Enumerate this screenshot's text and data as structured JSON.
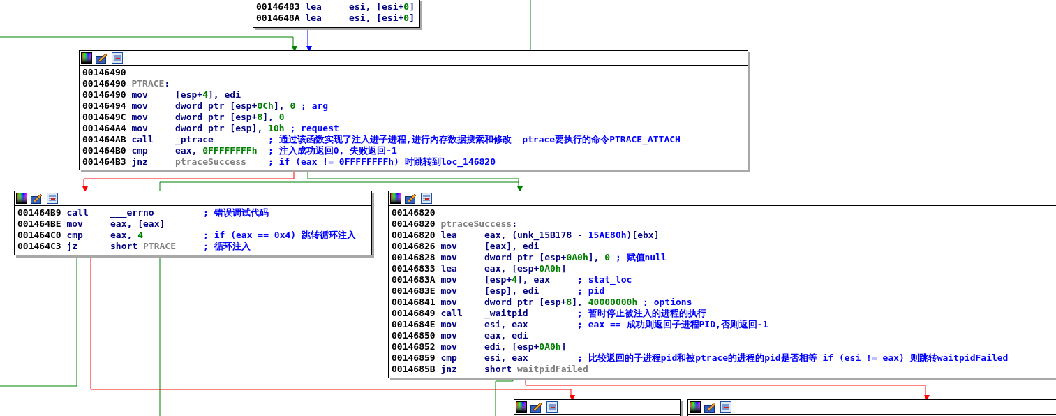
{
  "nodes": [
    {
      "toolbar": false,
      "lines": [
        {
          "kind": "insn",
          "address": "00146483",
          "mnemonic": "lea",
          "operands": [
            {
              "text": "esi, [esi+",
              "kind": "plain"
            },
            {
              "text": "0",
              "kind": "num"
            },
            {
              "text": "]",
              "kind": "plain"
            }
          ]
        },
        {
          "kind": "insn",
          "address": "0014648A",
          "mnemonic": "lea",
          "operands": [
            {
              "text": "esi, [esi+",
              "kind": "plain"
            },
            {
              "text": "0",
              "kind": "num"
            },
            {
              "text": "]",
              "kind": "plain"
            }
          ]
        }
      ]
    },
    {
      "toolbar": true,
      "lines": [
        {
          "kind": "blank",
          "address": "00146490"
        },
        {
          "kind": "label",
          "address": "00146490",
          "operands": [
            {
              "text": "PTRACE",
              "kind": "label"
            },
            {
              "text": ":",
              "kind": "plain"
            }
          ]
        },
        {
          "kind": "insn",
          "address": "00146490",
          "mnemonic": "mov",
          "operands": [
            {
              "text": "[esp+",
              "kind": "plain"
            },
            {
              "text": "4",
              "kind": "num"
            },
            {
              "text": "], edi",
              "kind": "plain"
            }
          ]
        },
        {
          "kind": "insn",
          "address": "00146494",
          "mnemonic": "mov",
          "operands": [
            {
              "text": "dword ptr [esp+",
              "kind": "plain"
            },
            {
              "text": "0Ch",
              "kind": "num"
            },
            {
              "text": "], ",
              "kind": "plain"
            },
            {
              "text": "0",
              "kind": "num"
            }
          ],
          "comment": "; arg"
        },
        {
          "kind": "insn",
          "address": "0014649C",
          "mnemonic": "mov",
          "operands": [
            {
              "text": "dword ptr [esp+",
              "kind": "plain"
            },
            {
              "text": "8",
              "kind": "num"
            },
            {
              "text": "], ",
              "kind": "plain"
            },
            {
              "text": "0",
              "kind": "num"
            }
          ]
        },
        {
          "kind": "insn",
          "address": "001464A4",
          "mnemonic": "mov",
          "operands": [
            {
              "text": "dword ptr [esp], ",
              "kind": "plain"
            },
            {
              "text": "10h",
              "kind": "num"
            }
          ],
          "comment": "; request"
        },
        {
          "kind": "insn",
          "address": "001464AB",
          "mnemonic": "call",
          "operands": [
            {
              "text": "_ptrace",
              "kind": "plain"
            }
          ],
          "comment": "; 通过该函数实现了注入进子进程,进行内存数据搜索和修改  ptrace要执行的命令PTRACE_ATTACH"
        },
        {
          "kind": "insn",
          "address": "001464B0",
          "mnemonic": "cmp",
          "operands": [
            {
              "text": "eax, ",
              "kind": "plain"
            },
            {
              "text": "0FFFFFFFFh",
              "kind": "num"
            }
          ],
          "comment": "; 注入成功返回0, 失败返回-1"
        },
        {
          "kind": "insn",
          "address": "001464B3",
          "mnemonic": "jnz",
          "operands": [
            {
              "text": "ptraceSuccess",
              "kind": "label"
            }
          ],
          "comment": "; if (eax != 0FFFFFFFFh) 时跳转到loc_146820"
        }
      ]
    },
    {
      "toolbar": true,
      "lines": [
        {
          "kind": "insn",
          "address": "001464B9",
          "mnemonic": "call",
          "operands": [
            {
              "text": "___errno",
              "kind": "plain"
            }
          ],
          "comment": "; 错误调试代码"
        },
        {
          "kind": "insn",
          "address": "001464BE",
          "mnemonic": "mov",
          "operands": [
            {
              "text": "eax, [eax]",
              "kind": "plain"
            }
          ]
        },
        {
          "kind": "insn",
          "address": "001464C0",
          "mnemonic": "cmp",
          "operands": [
            {
              "text": "eax, ",
              "kind": "plain"
            },
            {
              "text": "4",
              "kind": "num"
            }
          ],
          "comment": "; if (eax == 0x4) 跳转循环注入"
        },
        {
          "kind": "insn",
          "address": "001464C3",
          "mnemonic": "jz",
          "operands": [
            {
              "text": "short ",
              "kind": "plain"
            },
            {
              "text": "PTRACE",
              "kind": "label"
            }
          ],
          "comment": "; 循环注入"
        }
      ]
    },
    {
      "toolbar": true,
      "lines": [
        {
          "kind": "blank",
          "address": "00146820"
        },
        {
          "kind": "label",
          "address": "00146820",
          "operands": [
            {
              "text": "ptraceSuccess",
              "kind": "label"
            },
            {
              "text": ":",
              "kind": "plain"
            }
          ]
        },
        {
          "kind": "insn",
          "address": "00146820",
          "mnemonic": "lea",
          "operands": [
            {
              "text": "eax, (unk_15B178 - ",
              "kind": "plain"
            },
            {
              "text": "15AE80h",
              "kind": "name"
            },
            {
              "text": ")[ebx]",
              "kind": "plain"
            }
          ]
        },
        {
          "kind": "insn",
          "address": "00146826",
          "mnemonic": "mov",
          "operands": [
            {
              "text": "[eax], edi",
              "kind": "plain"
            }
          ]
        },
        {
          "kind": "insn",
          "address": "00146828",
          "mnemonic": "mov",
          "operands": [
            {
              "text": "dword ptr [esp+",
              "kind": "plain"
            },
            {
              "text": "0A0h",
              "kind": "num"
            },
            {
              "text": "], ",
              "kind": "plain"
            },
            {
              "text": "0",
              "kind": "num"
            }
          ],
          "comment": "; 赋值null"
        },
        {
          "kind": "insn",
          "address": "00146833",
          "mnemonic": "lea",
          "operands": [
            {
              "text": "eax, [esp+",
              "kind": "plain"
            },
            {
              "text": "0A0h",
              "kind": "num"
            },
            {
              "text": "]",
              "kind": "plain"
            }
          ]
        },
        {
          "kind": "insn",
          "address": "0014683A",
          "mnemonic": "mov",
          "operands": [
            {
              "text": "[esp+",
              "kind": "plain"
            },
            {
              "text": "4",
              "kind": "num"
            },
            {
              "text": "], eax",
              "kind": "plain"
            }
          ],
          "comment": "; stat_loc"
        },
        {
          "kind": "insn",
          "address": "0014683E",
          "mnemonic": "mov",
          "operands": [
            {
              "text": "[esp], edi",
              "kind": "plain"
            }
          ],
          "comment": "; pid"
        },
        {
          "kind": "insn",
          "address": "00146841",
          "mnemonic": "mov",
          "operands": [
            {
              "text": "dword ptr [esp+",
              "kind": "plain"
            },
            {
              "text": "8",
              "kind": "num"
            },
            {
              "text": "], ",
              "kind": "plain"
            },
            {
              "text": "40000000h",
              "kind": "num"
            }
          ],
          "comment": "; options"
        },
        {
          "kind": "insn",
          "address": "00146849",
          "mnemonic": "call",
          "operands": [
            {
              "text": "_waitpid",
              "kind": "plain"
            }
          ],
          "comment": "; 暂时停止被注入的进程的执行"
        },
        {
          "kind": "insn",
          "address": "0014684E",
          "mnemonic": "mov",
          "operands": [
            {
              "text": "esi, eax",
              "kind": "plain"
            }
          ],
          "comment": "; eax == 成功则返回子进程PID,否则返回-1"
        },
        {
          "kind": "insn",
          "address": "00146850",
          "mnemonic": "mov",
          "operands": [
            {
              "text": "eax, edi",
              "kind": "plain"
            }
          ]
        },
        {
          "kind": "insn",
          "address": "00146852",
          "mnemonic": "mov",
          "operands": [
            {
              "text": "edi, [esp+",
              "kind": "plain"
            },
            {
              "text": "0A0h",
              "kind": "num"
            },
            {
              "text": "]",
              "kind": "plain"
            }
          ]
        },
        {
          "kind": "insn",
          "address": "00146859",
          "mnemonic": "cmp",
          "operands": [
            {
              "text": "esi, eax",
              "kind": "plain"
            }
          ],
          "comment": "; 比较返回的子进程pid和被ptrace的进程的pid是否相等 if (esi != eax) 则跳转waitpidFailed"
        },
        {
          "kind": "insn",
          "address": "0014685B",
          "mnemonic": "jnz",
          "operands": [
            {
              "text": "short ",
              "kind": "plain"
            },
            {
              "text": "waitpidFailed",
              "kind": "label"
            }
          ]
        }
      ]
    },
    {
      "toolbar": true
    },
    {
      "toolbar": true
    }
  ],
  "edges": [
    {
      "kind": "yes"
    },
    {
      "kind": "flow"
    },
    {
      "kind": "yes"
    },
    {
      "kind": "no"
    },
    {
      "kind": "yes"
    },
    {
      "kind": "yes"
    },
    {
      "kind": "yes"
    },
    {
      "kind": "no"
    },
    {
      "kind": "yes"
    },
    {
      "kind": "no"
    }
  ]
}
